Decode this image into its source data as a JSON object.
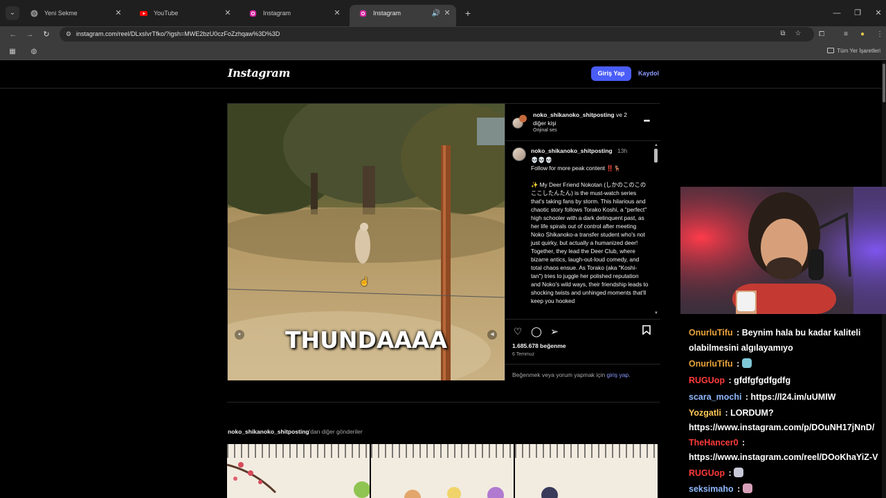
{
  "browser": {
    "tabs": [
      {
        "title": "Yeni Sekme",
        "icon": "chrome-icon"
      },
      {
        "title": "YouTube",
        "icon": "youtube-icon"
      },
      {
        "title": "Instagram",
        "icon": "instagram-icon"
      },
      {
        "title": "Instagram",
        "icon": "instagram-icon",
        "active": true,
        "muted": true
      }
    ],
    "url": "instagram.com/reel/DLxsIvrTfko/?igsh=MWE2bzU0czFoZzhqaw%3D%3D",
    "bookmarks_label": "Tüm Yer İşaretleri"
  },
  "instagram": {
    "logo": "Instagram",
    "login_button": "Giriş Yap",
    "signup_link": "Kaydol",
    "post": {
      "overlay_caption": "THUNDAAAA",
      "header_user": "noko_shikanoko_shitposting",
      "header_others": " ve 2 diğer kişi",
      "audio": "Orijinal ses",
      "caption_user": "noko_shikanoko_shitposting",
      "caption_time": "13h",
      "caption_text": "💀💀💀\nFollow for more peak content ‼️🦌\n\n✨ My Deer Friend Nokotan (しかのこのこのここしたんたん) is the must-watch series that's taking fans by storm. This hilarious and chaotic story follows Torako Koshi, a \"perfect\" high schooler with a dark delinquent past, as her life spirals out of control after meeting Noko Shikanoko-a transfer student who's not just quirky, but actually a humanized deer! Together, they lead the Deer Club, where bizarre antics, laugh-out-loud comedy, and total chaos ensue. As Torako (aka \"Koshi-tan\") tries to juggle her polished reputation and Noko's wild ways, their friendship leads to shocking twists and unhinged moments that'll keep you hooked",
      "likes": "1.685.678 beğenme",
      "date": "6 Temmuz",
      "login_prompt_text": "Beğenmek veya yorum yapmak için ",
      "login_prompt_link": "giriş yap",
      "login_prompt_end": "."
    },
    "more_posts_user": "noko_shikanoko_shitposting",
    "more_posts_suffix": "'dan diğer gönderiler"
  },
  "chat": {
    "messages": [
      {
        "user": "OnurluTifu",
        "text": " : Beynim hala bu kadar kaliteli",
        "color": "#e8a23a"
      },
      {
        "user": "",
        "text": "olabilmesini algılayamıyo",
        "color": "#ffffff"
      },
      {
        "user": "OnurluTifu",
        "text": " : ",
        "color": "#e8a23a",
        "emoji": true
      },
      {
        "user": "RUGUop",
        "text": " : gfdfgfgdfgdfg",
        "color": "#ff3b3b"
      },
      {
        "user": "scara_mochi",
        "text": " : https://l24.im/uUMIW",
        "color": "#8fb8ff"
      },
      {
        "user": "Yozgatli",
        "text": " : LORDUM?",
        "color": "#ffc857"
      },
      {
        "user": "",
        "text": "https://www.instagram.com/p/DOuNH17jNnD/",
        "color": "#ffffff"
      },
      {
        "user": "TheHancer0",
        "text": " :",
        "color": "#ff3b3b"
      },
      {
        "user": "",
        "text": "https://www.instagram.com/reel/DOoKhaYiZ-V",
        "color": "#ffffff"
      },
      {
        "user": "RUGUop",
        "text": " : ",
        "color": "#ff3b3b",
        "emoji": true
      },
      {
        "user": "seksimaho",
        "text": " : ",
        "color": "#8fb8ff",
        "emoji": true
      }
    ]
  }
}
